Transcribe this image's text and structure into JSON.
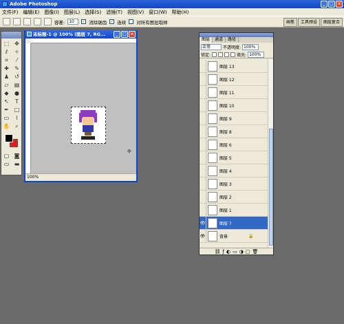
{
  "app": {
    "title": "Adobe Photoshop",
    "window_controls": [
      "_",
      "□",
      "×"
    ]
  },
  "menu": [
    "文件(F)",
    "编辑(E)",
    "图像(I)",
    "图层(L)",
    "选择(S)",
    "滤镜(T)",
    "视图(V)",
    "窗口(W)",
    "帮助(H)"
  ],
  "options": {
    "tolerance_label": "容差:",
    "tolerance_value": "10",
    "anti_alias_label": "消除锯齿",
    "contiguous_label": "连续",
    "all_layers_label": "对所有图层取样",
    "well_tabs": [
      "画笔",
      "工具预设",
      "图层复合"
    ]
  },
  "document": {
    "title": "未标题-1 @ 100% (图层 7, RG...",
    "zoom": "100%",
    "controls": [
      "_",
      "□",
      "×"
    ]
  },
  "colors": {
    "foreground": "#000000",
    "background": "#e31b1b",
    "accent": "#3168c6"
  },
  "layers_panel": {
    "tabs": [
      "图层",
      "通道",
      "路径"
    ],
    "blend_mode": "正常",
    "opacity_label": "不透明度:",
    "opacity_value": "100%",
    "lock_label": "锁定:",
    "fill_label": "填充:",
    "fill_value": "100%",
    "layers": [
      {
        "name": "图层 13",
        "visible": false,
        "selected": false
      },
      {
        "name": "图层 12",
        "visible": false,
        "selected": false
      },
      {
        "name": "图层 11",
        "visible": false,
        "selected": false
      },
      {
        "name": "图层 10",
        "visible": false,
        "selected": false
      },
      {
        "name": "图层 9",
        "visible": false,
        "selected": false
      },
      {
        "name": "图层 8",
        "visible": false,
        "selected": false
      },
      {
        "name": "图层 6",
        "visible": false,
        "selected": false
      },
      {
        "name": "图层 5",
        "visible": false,
        "selected": false
      },
      {
        "name": "图层 4",
        "visible": false,
        "selected": false
      },
      {
        "name": "图层 3",
        "visible": false,
        "selected": false
      },
      {
        "name": "图层 2",
        "visible": false,
        "selected": false
      },
      {
        "name": "图层 1",
        "visible": false,
        "selected": false
      },
      {
        "name": "图层 7",
        "visible": true,
        "selected": true
      },
      {
        "name": "背景",
        "visible": true,
        "selected": false
      }
    ],
    "footer_icons": [
      "link-icon",
      "style-icon",
      "mask-icon",
      "set-icon",
      "adjustment-icon",
      "new-layer-icon",
      "trash-icon"
    ]
  }
}
